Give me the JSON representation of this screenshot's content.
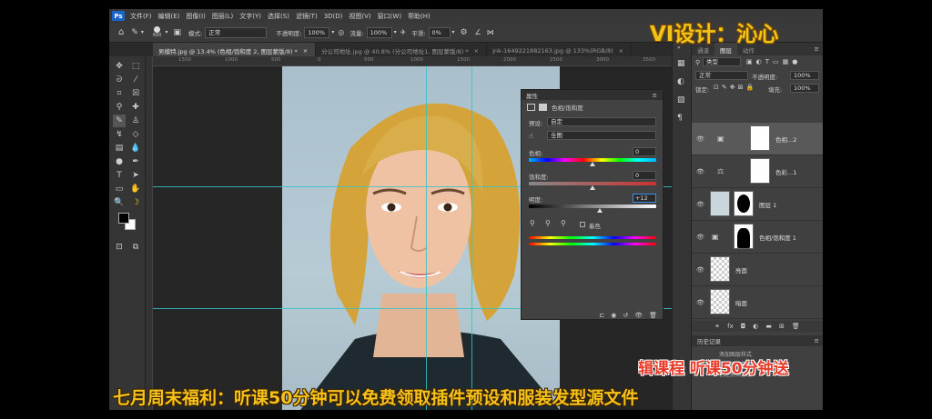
{
  "app": {
    "logo": "Ps"
  },
  "menu": [
    "文件(F)",
    "编辑(E)",
    "图像(I)",
    "图层(L)",
    "文字(Y)",
    "选择(S)",
    "滤镜(T)",
    "3D(D)",
    "视图(V)",
    "窗口(W)",
    "帮助(H)"
  ],
  "options": {
    "brush_size": "600",
    "mode_label": "模式:",
    "mode_value": "正常",
    "opacity_label": "不透明度:",
    "opacity_value": "100%",
    "flow_label": "流量:",
    "flow_value": "100%",
    "smooth_label": "平滑:",
    "smooth_value": "0%"
  },
  "tabs": [
    "男模特.jpg @ 13.4% (色相/饱和度 2, 图层蒙版/8) *",
    "分公司地址.jpg @ 40.8% (分公司地址1, 图层蒙版/8) *",
    "jnk-1649221882163.jpg @ 133%(RGB/8)"
  ],
  "ruler": [
    "1500",
    "1000",
    "500",
    "0",
    "500",
    "1000",
    "1500",
    "2000",
    "2500",
    "3000",
    "3500"
  ],
  "properties": {
    "title": "属性",
    "adjustment": "色相/饱和度",
    "preset_label": "预设:",
    "preset_value": "自定",
    "channel_value": "全图",
    "hue_label": "色相:",
    "hue_value": 0,
    "saturation_label": "饱和度:",
    "saturation_value": 0,
    "lightness_label": "明度:",
    "lightness_value": "+12",
    "colorize_label": "着色"
  },
  "panel_tabs": [
    "通道",
    "图层",
    "动作"
  ],
  "layers_panel": {
    "kind_value": "类型",
    "blend_mode": "正常",
    "opacity_label": "不透明度:",
    "opacity_value": "100%",
    "lock_label": "锁定:",
    "fill_label": "填充:",
    "fill_value": "100%",
    "layers": [
      "色相...2",
      "色彩...1",
      "图层 1",
      "色相/饱和度 1",
      "亮面",
      "暗面"
    ]
  },
  "history_title": "历史记录",
  "history_items": [
    "添加图层样式",
    "创建剪贴蒙版",
    "创建剪贴蒙版"
  ],
  "overlay": {
    "watermark": "VI设计：沁心",
    "scrolling": "辑课程  听课50分钟送",
    "promo": "七月周末福利：听课50分钟可以免费领取插件预设和服装发型源文件"
  },
  "colors": {
    "accent": "#1b63c9",
    "guide": "#35c4c4",
    "promo_yellow": "#f6c21a",
    "scroll_red": "#e83a2a"
  }
}
